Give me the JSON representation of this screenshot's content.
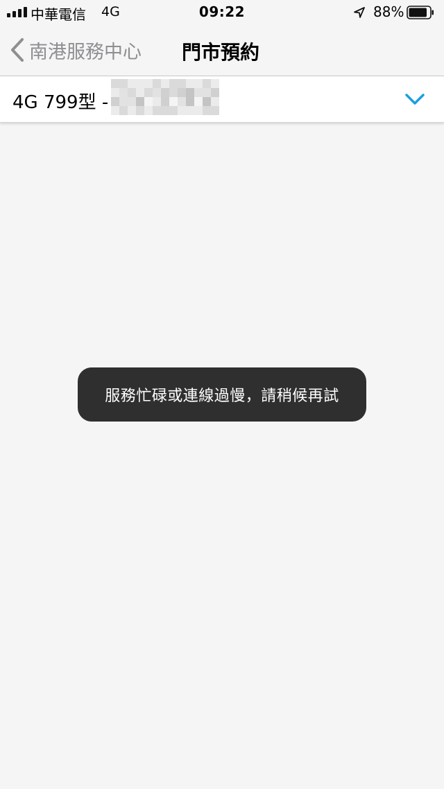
{
  "status_bar": {
    "carrier": "中華電信",
    "network": "4G",
    "time": "09:22",
    "battery_percent": "88%",
    "battery_level": 0.88,
    "icons": [
      "signal-icon",
      "location-arrow-icon",
      "battery-icon"
    ]
  },
  "nav": {
    "back_label": "南港服務中心",
    "title": "門市預約",
    "icons": [
      "chevron-left-icon"
    ]
  },
  "plan_selector": {
    "label": "4G 799型 -",
    "icons": [
      "chevron-down-icon"
    ]
  },
  "toast": {
    "message": "服務忙碌或連線過慢，請稍候再試"
  },
  "colors": {
    "background": "#f5f5f5",
    "accent": "#1a9fe0",
    "back_gray": "#8e8e93",
    "toast_bg": "#2f2f2f"
  }
}
